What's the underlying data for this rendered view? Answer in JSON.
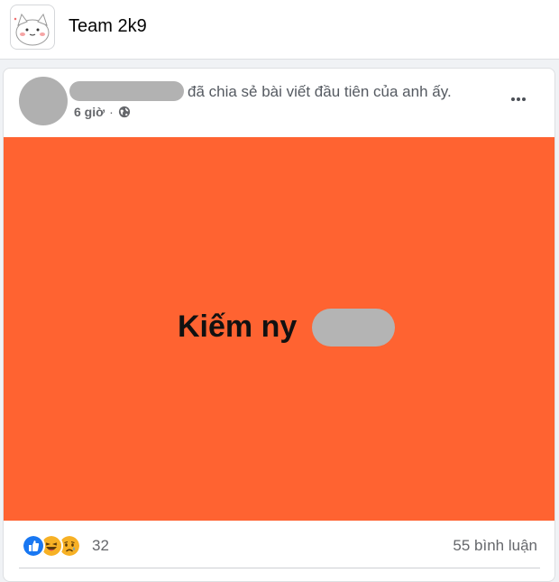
{
  "group": {
    "name": "Team 2k9"
  },
  "post": {
    "shared_text": "đã chia sẻ bài viết đầu tiên của anh ấy.",
    "time": "6 giờ",
    "separator": "·",
    "privacy_icon": "globe-icon",
    "image": {
      "background": "#ff6331",
      "text": "Kiếm ny"
    },
    "reactions": {
      "icons": [
        "like-icon",
        "haha-icon",
        "sad-icon"
      ],
      "count": "32"
    },
    "comments": "55 bình luận"
  },
  "colors": {
    "accent_blue": "#1877f2",
    "reaction_yellow": "#f7b125",
    "image_orange": "#ff6331"
  }
}
